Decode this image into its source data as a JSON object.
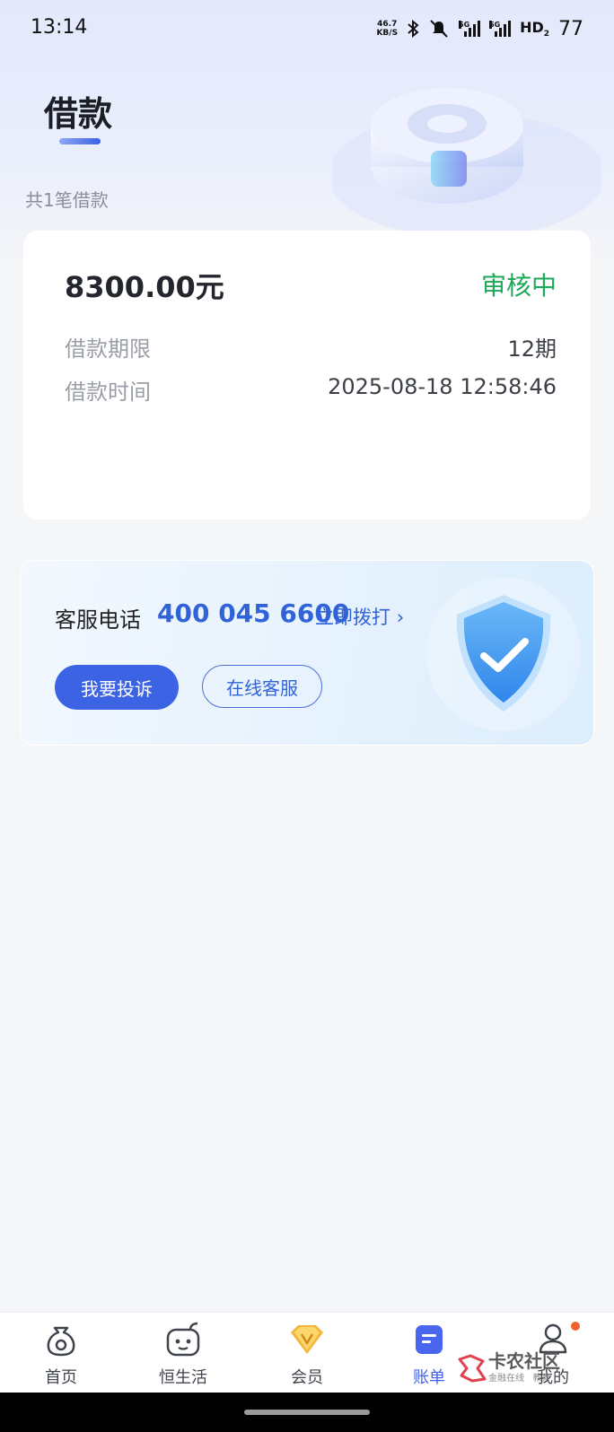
{
  "status_bar": {
    "time": "13:14",
    "net_speed_value": "46.7",
    "net_speed_unit": "KB/S",
    "network_1": "5G",
    "network_2": "5G",
    "hd": "HD",
    "hd_sub": "2",
    "battery": "77"
  },
  "page": {
    "title": "借款",
    "count_text": "共1笔借款"
  },
  "loan": {
    "amount": "8300.00元",
    "status": "审核中",
    "status_color": "#1ea85a",
    "rows": [
      {
        "label": "借款期限",
        "value": "12期"
      },
      {
        "label": "借款时间",
        "value": "2025-08-18 12:58:46"
      }
    ]
  },
  "service": {
    "label": "客服电话",
    "phone": "400 045 6600",
    "call_label": "立即拨打",
    "complaint_label": "我要投诉",
    "online_label": "在线客服"
  },
  "nav": {
    "items": [
      {
        "label": "首页",
        "icon": "home-money-bag-icon"
      },
      {
        "label": "恒生活",
        "icon": "life-icon"
      },
      {
        "label": "会员",
        "icon": "vip-diamond-icon"
      },
      {
        "label": "账单",
        "icon": "bill-icon",
        "active": true
      },
      {
        "label": "我的",
        "icon": "profile-icon"
      }
    ],
    "active_color": "#4461e8"
  },
  "watermark": {
    "title": "卡农社区",
    "subtitle": "金融在线   教育"
  },
  "accent_color": "#3c63e4"
}
